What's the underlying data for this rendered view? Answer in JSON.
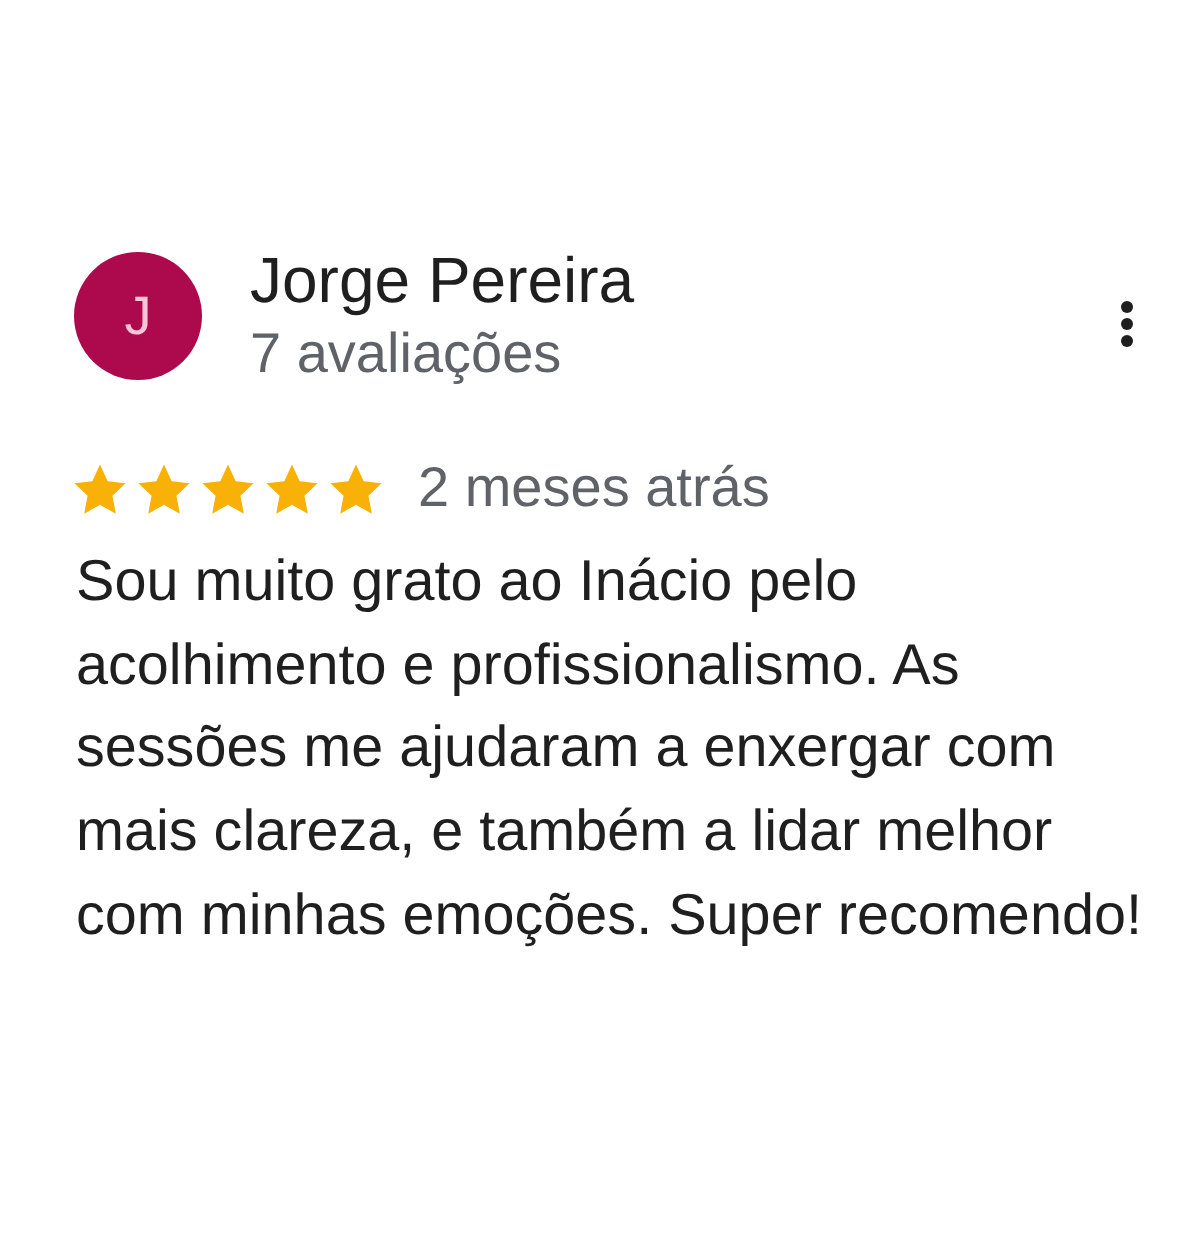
{
  "review": {
    "avatar_letter": "J",
    "author": "Jorge Pereira",
    "review_count": "7 avaliações",
    "stars": 5,
    "time": "2 meses atrás",
    "text": "Sou muito grato ao Inácio pelo acolhimento e profissionalismo. As sessões me ajudaram a enxergar com mais clareza, e também a lidar melhor com minhas emoções. Super recomendo!"
  }
}
